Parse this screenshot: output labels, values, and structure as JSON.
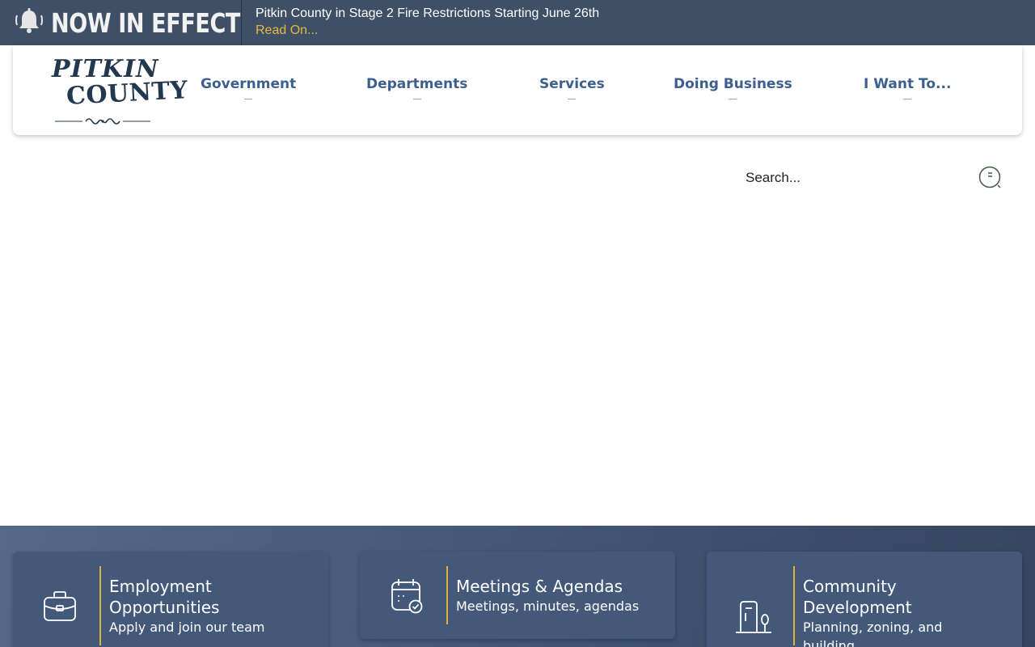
{
  "alert": {
    "label": "NOW IN EFFECT",
    "icon": "bell-icon",
    "title": "Pitkin County in Stage 2 Fire Restrictions Starting June 26th",
    "link": "Read On..."
  },
  "logo": {
    "line1": "PITKIN",
    "line2": "COUNTY"
  },
  "nav": {
    "items": [
      {
        "label": "Government"
      },
      {
        "label": "Departments"
      },
      {
        "label": "Services"
      },
      {
        "label": "Doing Business"
      },
      {
        "label": "I Want To..."
      }
    ]
  },
  "search": {
    "placeholder": "Search...",
    "icon": "search-icon"
  },
  "cards": [
    {
      "title": "Employment Opportunities",
      "subtitle": "Apply and join our team",
      "icon": "briefcase-icon"
    },
    {
      "title": "Meetings & Agendas",
      "subtitle": "Meetings, minutes, agendas",
      "icon": "calendar-check-icon"
    },
    {
      "title": "Community Development",
      "subtitle": "Planning, zoning, and building",
      "icon": "building-tree-icon"
    }
  ],
  "colors": {
    "alert_bg": "#3f4f66",
    "link_gold": "#e5b93e",
    "nav_blue": "#3d5f8e",
    "card_bg": "#44597a",
    "accent_divider": "#e0b43b"
  }
}
